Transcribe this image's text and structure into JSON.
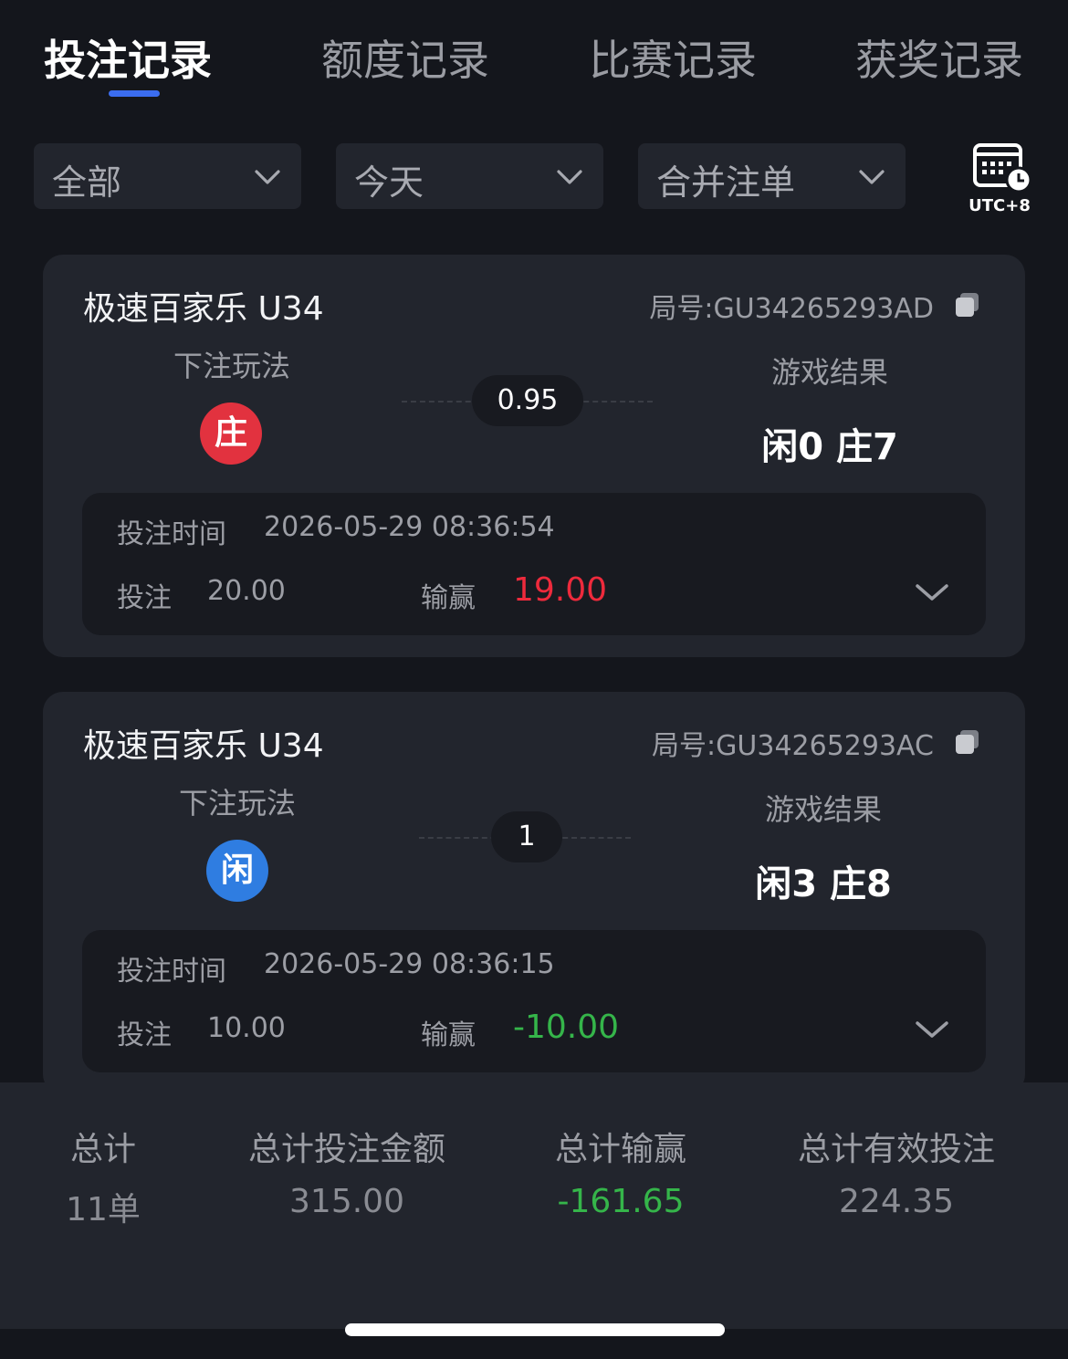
{
  "tabs": [
    {
      "label": "投注记录",
      "active": true
    },
    {
      "label": "额度记录",
      "active": false
    },
    {
      "label": "比赛记录",
      "active": false
    },
    {
      "label": "获奖记录",
      "active": false
    }
  ],
  "filters": {
    "scope": "全部",
    "date": "今天",
    "mode": "合并注单",
    "timezone": "UTC+8"
  },
  "bets": [
    {
      "game": "极速百家乐 U34",
      "round": "局号:GU34265293AD",
      "bet_label": "下注玩法",
      "bet_type": "庄",
      "odds": "0.95",
      "result_label": "游戏结果",
      "result": "闲0 庄7",
      "time_label": "投注时间",
      "time": "2026-05-29 08:36:54",
      "stake_label": "投注",
      "stake": "20.00",
      "pl_label": "输赢",
      "pl": "19.00"
    },
    {
      "game": "极速百家乐 U34",
      "round": "局号:GU34265293AC",
      "bet_label": "下注玩法",
      "bet_type": "闲",
      "odds": "1",
      "result_label": "游戏结果",
      "result": "闲3 庄8",
      "time_label": "投注时间",
      "time": "2026-05-29 08:36:15",
      "stake_label": "投注",
      "stake": "10.00",
      "pl_label": "输赢",
      "pl": "-10.00"
    }
  ],
  "summary": {
    "total_label": "总计",
    "total_value": "11单",
    "stake_label": "总计投注金额",
    "stake_value": "315.00",
    "pl_label": "总计输赢",
    "pl_value": "-161.65",
    "valid_label": "总计有效投注",
    "valid_value": "224.35"
  },
  "colors": {
    "accent": "#3b6df0",
    "banker": "#e2323f",
    "player": "#2f7de1",
    "win": "#ee2a3c",
    "loss": "#35b54a"
  }
}
